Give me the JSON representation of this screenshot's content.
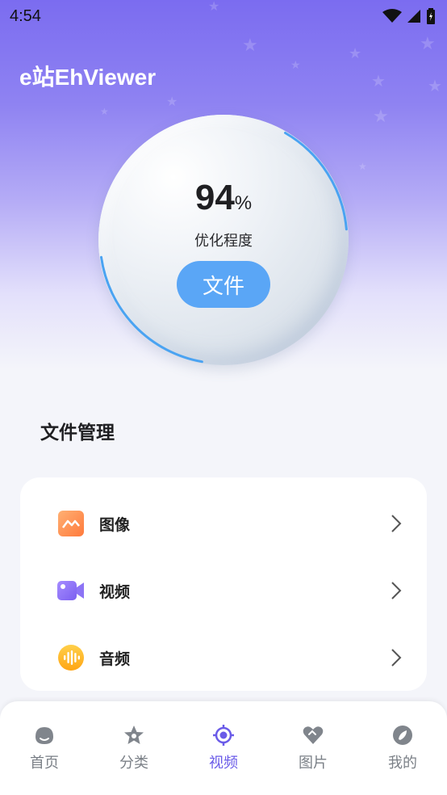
{
  "status_bar": {
    "time": "4:54"
  },
  "app": {
    "title": "e站EhViewer"
  },
  "gauge": {
    "value": "94",
    "unit": "%",
    "label": "优化程度",
    "button_label": "文件",
    "progress": 0.94
  },
  "section": {
    "title": "文件管理"
  },
  "file_items": [
    {
      "label": "图像",
      "icon": "image-icon",
      "color": "#ff8a4c"
    },
    {
      "label": "视频",
      "icon": "video-icon",
      "color": "#8b72f0"
    },
    {
      "label": "音频",
      "icon": "audio-icon",
      "color": "#ffb21e"
    }
  ],
  "tabs": [
    {
      "label": "首页",
      "icon": "home-icon",
      "active": false
    },
    {
      "label": "分类",
      "icon": "category-icon",
      "active": false
    },
    {
      "label": "视频",
      "icon": "video-target-icon",
      "active": true
    },
    {
      "label": "图片",
      "icon": "picture-icon",
      "active": false
    },
    {
      "label": "我的",
      "icon": "profile-icon",
      "active": false
    }
  ],
  "colors": {
    "accent": "#6a5be8",
    "button": "#5aa6f6",
    "ring": "#4aa3f2"
  }
}
